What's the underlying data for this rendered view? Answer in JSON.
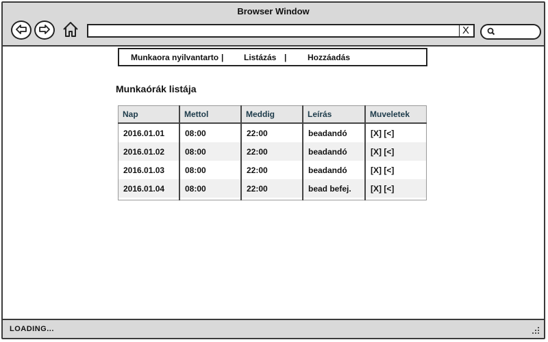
{
  "window": {
    "title": "Browser Window"
  },
  "browser": {
    "url": "",
    "clear_label": "X"
  },
  "menu": {
    "items": [
      {
        "label": "Munkaora nyilvantarto"
      },
      {
        "label": "Listázás"
      },
      {
        "label": "Hozzáadás"
      }
    ],
    "separator": "|"
  },
  "page": {
    "heading": "Munkaórák listája"
  },
  "table": {
    "columns": [
      "Nap",
      "Mettol",
      "Meddig",
      "Leírás",
      "Muveletek"
    ],
    "rows": [
      [
        "2016.01.01",
        "08:00",
        "22:00",
        "beadandó",
        "[X] [<]"
      ],
      [
        "2016.01.02",
        "08:00",
        "22:00",
        "beadandó",
        "[X] [<]"
      ],
      [
        "2016.01.03",
        "08:00",
        "22:00",
        "beadandó",
        "[X] [<]"
      ],
      [
        "2016.01.04",
        "08:00",
        "22:00",
        "bead befej.",
        "[X] [<]"
      ]
    ]
  },
  "status": {
    "text": "LOADING..."
  },
  "icons": {
    "back": "back-arrow-icon",
    "forward": "forward-arrow-icon",
    "home": "home-icon",
    "search": "search-icon",
    "resize": "resize-grip-icon"
  }
}
